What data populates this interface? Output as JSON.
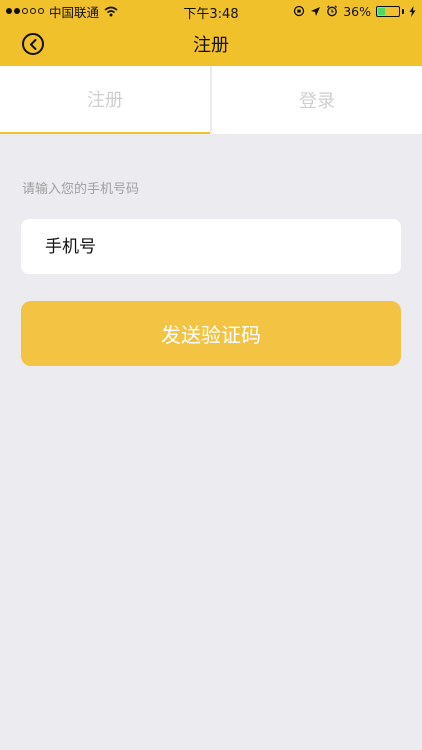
{
  "status_bar": {
    "carrier": "中国联通",
    "time": "下午3:48",
    "battery_percent": "36%",
    "battery_level": 0.36
  },
  "nav": {
    "title": "注册",
    "back_icon": "chevron-left-circle-icon"
  },
  "tabs": [
    {
      "label": "注册",
      "active": true
    },
    {
      "label": "登录",
      "active": false
    }
  ],
  "form": {
    "hint": "请输入您的手机号码",
    "phone_placeholder": "手机号",
    "phone_value": "",
    "send_button": "发送验证码"
  },
  "colors": {
    "accent": "#f0c12a",
    "button": "#f3c443",
    "background": "#ebebf0"
  }
}
